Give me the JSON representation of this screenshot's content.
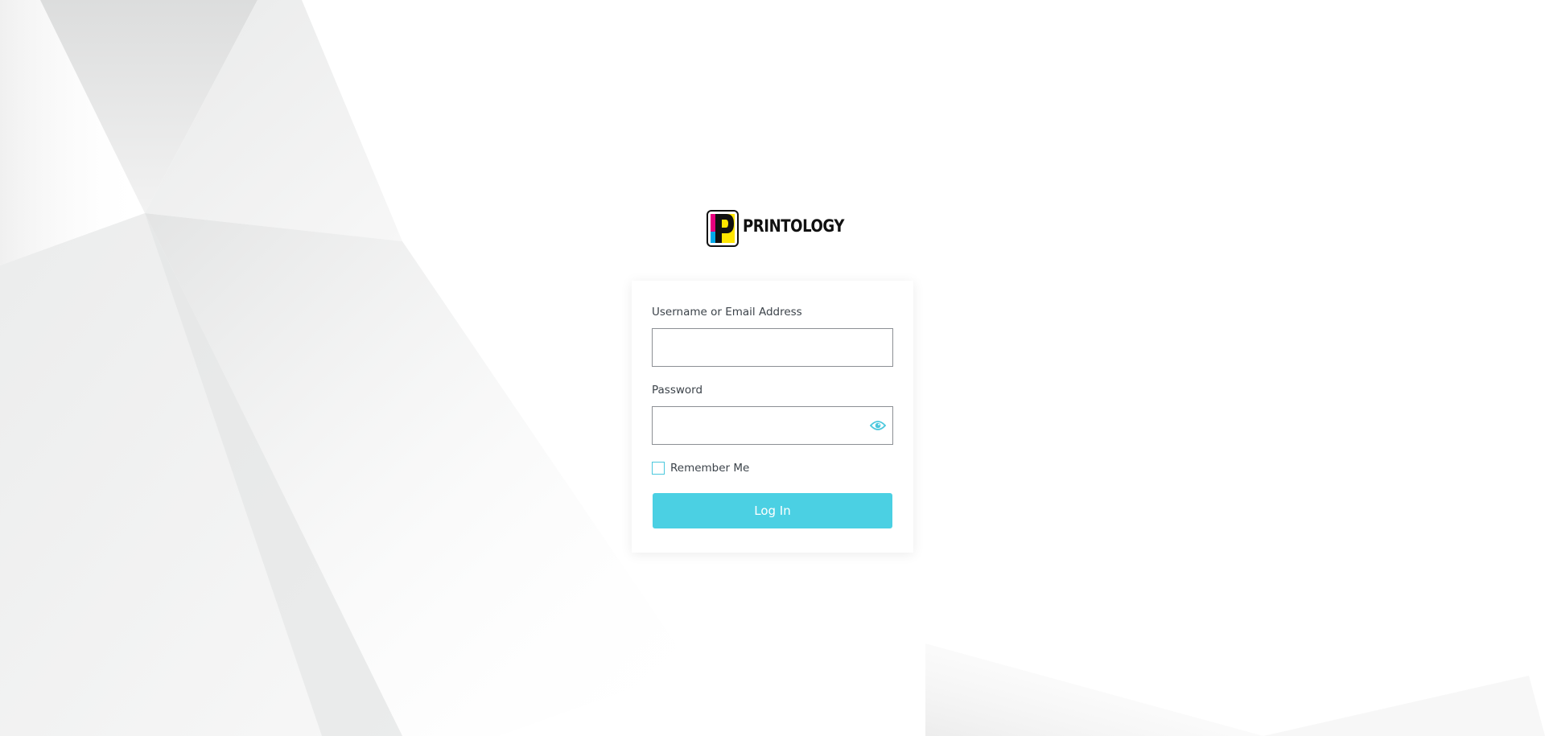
{
  "logo": {
    "wordmark": "PRINTOLOGY",
    "colors": {
      "magenta": "#e6007e",
      "yellow": "#ffe600",
      "cyan": "#00a8e8",
      "black": "#111111"
    }
  },
  "login_form": {
    "username_label": "Username or Email Address",
    "username_value": "",
    "password_label": "Password",
    "password_value": "",
    "show_password_icon": "eye-icon",
    "remember_me_label": "Remember Me",
    "remember_me_checked": false,
    "submit_label": "Log In"
  },
  "colors": {
    "accent": "#4bd0e3",
    "checkbox_border": "#4bc8dd",
    "input_border": "#8c8f94",
    "label_text": "#3c434a"
  }
}
